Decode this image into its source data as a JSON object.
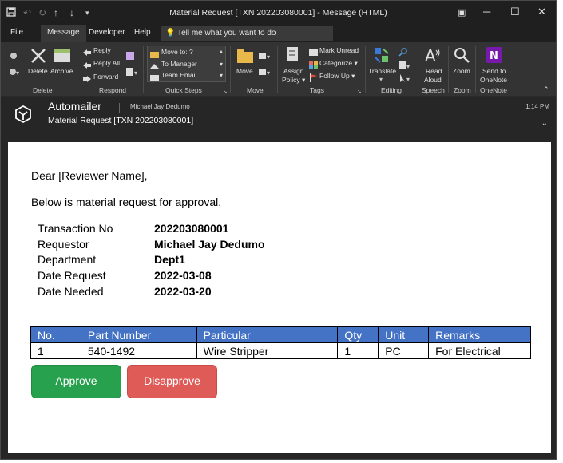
{
  "titlebar": {
    "title": "Material Request [TXN 202203080001]  -  Message (HTML)"
  },
  "tabs": {
    "file": "File",
    "message": "Message",
    "developer": "Developer",
    "help": "Help",
    "tellme": "Tell me what you want to do"
  },
  "ribbon": {
    "delete": "Delete",
    "archive": "Archive",
    "reply": "Reply",
    "reply_all": "Reply All",
    "forward": "Forward",
    "move_to": "Move to: ?",
    "to_manager": "To Manager",
    "team_email": "Team Email",
    "move": "Move",
    "assign_policy": [
      "Assign",
      "Policy ▾"
    ],
    "mark_unread": "Mark Unread",
    "categorize": "Categorize ▾",
    "follow_up": "Follow Up ▾",
    "translate": "Translate",
    "read_aloud": [
      "Read",
      "Aloud"
    ],
    "zoom": "Zoom",
    "send_onenote": [
      "Send to",
      "OneNote"
    ],
    "groups": {
      "delete": "Delete",
      "respond": "Respond",
      "quick_steps": "Quick Steps",
      "move": "Move",
      "tags": "Tags",
      "editing": "Editing",
      "speech": "Speech",
      "zoom": "Zoom",
      "onenote": "OneNote"
    }
  },
  "header": {
    "from_name": "Automailer",
    "from_email": "Michael Jay Dedumo",
    "subject": "Material Request [TXN 202203080001]",
    "time": "1:14 PM"
  },
  "email": {
    "greeting": "Dear [Reviewer Name],",
    "intro": "Below is material request for approval.",
    "details": [
      {
        "label": "Transaction No",
        "value": "202203080001"
      },
      {
        "label": "Requestor",
        "value": "Michael Jay Dedumo"
      },
      {
        "label": "Department",
        "value": "Dept1"
      },
      {
        "label": "Date Request",
        "value": "2022-03-08"
      },
      {
        "label": "Date Needed",
        "value": "2022-03-20"
      }
    ],
    "table": {
      "headers": [
        "No.",
        "Part Number",
        "Particular",
        "Qty",
        "Unit",
        "Remarks"
      ],
      "rows": [
        [
          "1",
          "540-1492",
          "Wire Stripper",
          "1",
          "PC",
          "For Electrical"
        ]
      ]
    },
    "approve_label": "Approve",
    "disapprove_label": "Disapprove"
  }
}
